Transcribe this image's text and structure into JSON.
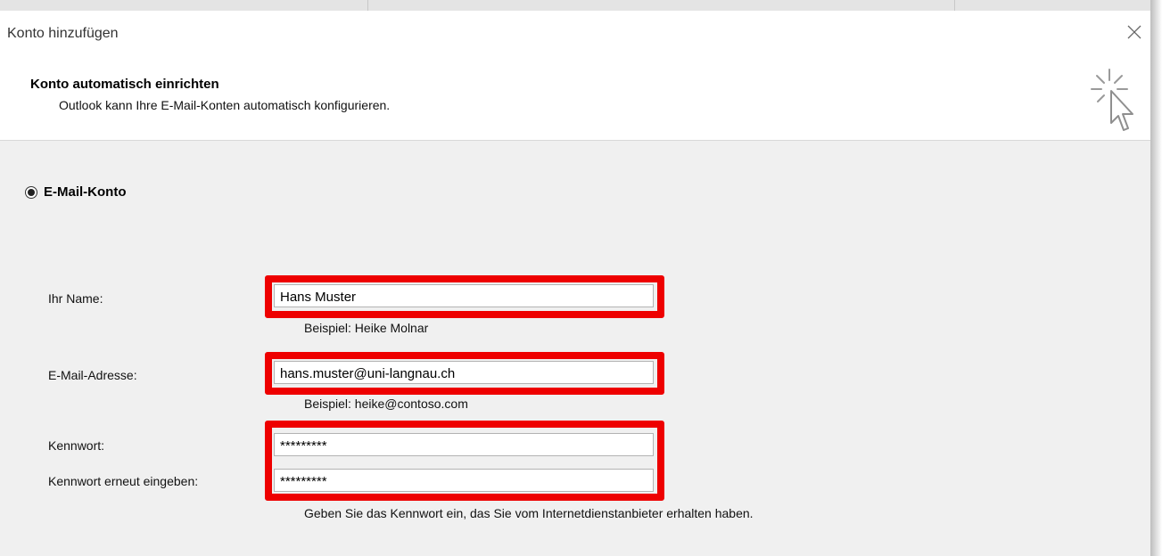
{
  "window": {
    "title": "Konto hinzufügen",
    "close_glyph": "✕"
  },
  "header": {
    "title": "Konto automatisch einrichten",
    "subtitle": "Outlook kann Ihre E-Mail-Konten automatisch konfigurieren.",
    "icon": "wizard-cursor-icon"
  },
  "account_type": {
    "label": "E-Mail-Konto",
    "selected": true
  },
  "form": {
    "name": {
      "label": "Ihr Name:",
      "value": "Hans Muster",
      "hint": "Beispiel: Heike Molnar"
    },
    "email": {
      "label": "E-Mail-Adresse:",
      "value": "hans.muster@uni-langnau.ch",
      "hint": "Beispiel: heike@contoso.com"
    },
    "password": {
      "label": "Kennwort:",
      "value": "*********"
    },
    "password_confirm": {
      "label": "Kennwort erneut eingeben:",
      "value": "*********"
    },
    "password_hint": "Geben Sie das Kennwort ein, das Sie vom Internetdienstanbieter erhalten haben."
  },
  "colors": {
    "highlight": "#ee0000",
    "dialog_bg": "#f0f0f0",
    "header_bg": "#ffffff"
  }
}
